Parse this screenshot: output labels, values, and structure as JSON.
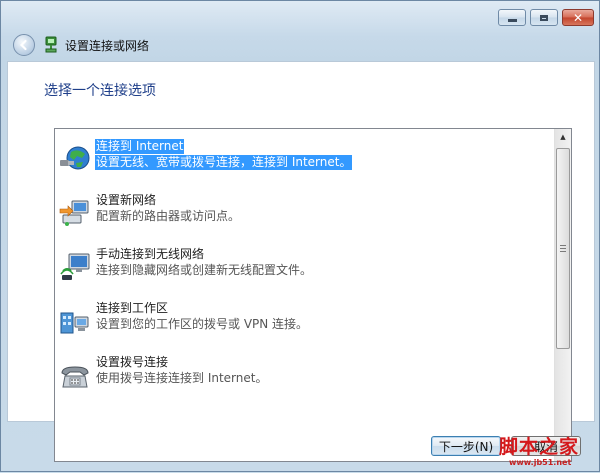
{
  "window": {
    "title": "设置连接或网络",
    "caption": {
      "minimize": "minimize",
      "maximize": "maximize",
      "close": "✕"
    }
  },
  "heading": "选择一个连接选项",
  "options": [
    {
      "title": "连接到 Internet",
      "description": "设置无线、宽带或拨号连接，连接到 Internet。",
      "icon": "globe-network-icon",
      "selected": true
    },
    {
      "title": "设置新网络",
      "description": "配置新的路由器或访问点。",
      "icon": "new-network-icon",
      "selected": false
    },
    {
      "title": "手动连接到无线网络",
      "description": "连接到隐藏网络或创建新无线配置文件。",
      "icon": "wireless-network-icon",
      "selected": false
    },
    {
      "title": "连接到工作区",
      "description": "设置到您的工作区的拨号或 VPN 连接。",
      "icon": "workplace-icon",
      "selected": false
    },
    {
      "title": "设置拨号连接",
      "description": "使用拨号连接连接到 Internet。",
      "icon": "dialup-phone-icon",
      "selected": false
    }
  ],
  "footer": {
    "next_label": "下一步(N)",
    "cancel_label": "取消"
  },
  "watermark": {
    "line1": "脚本之家",
    "line2": "www.jb51.net"
  },
  "colors": {
    "selection": "#3399ff",
    "heading": "#1f3f8a",
    "close_button": "#c2432c"
  }
}
